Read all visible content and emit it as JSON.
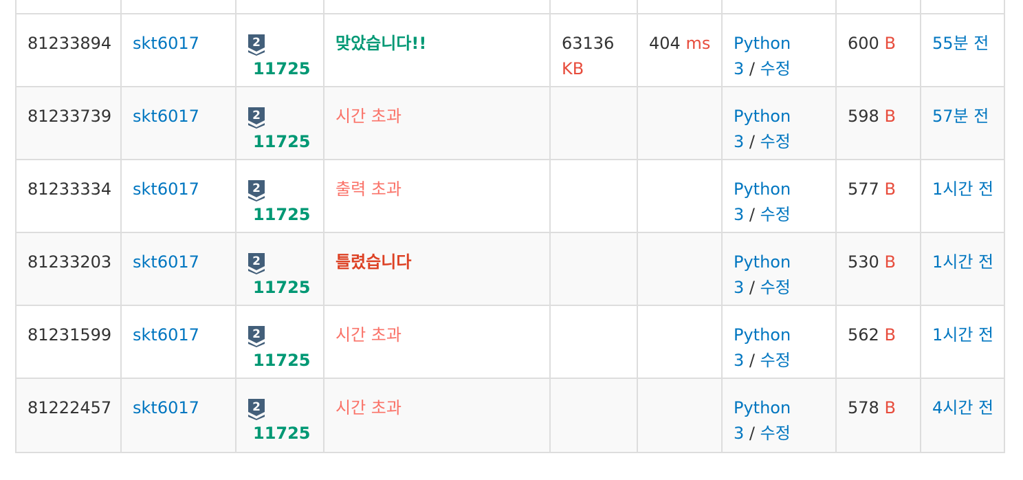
{
  "rows": [
    {
      "id": "81233894",
      "user": "skt6017",
      "problem": "11725",
      "result": "맞았습니다!!",
      "result_type": "ac",
      "memory": "63136",
      "memory_unit": "KB",
      "time": "404",
      "time_unit": "ms",
      "lang": "Python",
      "lang_ver": "3",
      "edit": "수정",
      "length": "600",
      "length_unit": "B",
      "submitted": "55분 전"
    },
    {
      "id": "81233739",
      "user": "skt6017",
      "problem": "11725",
      "result": "시간 초과",
      "result_type": "tle",
      "memory": "",
      "memory_unit": "",
      "time": "",
      "time_unit": "",
      "lang": "Python",
      "lang_ver": "3",
      "edit": "수정",
      "length": "598",
      "length_unit": "B",
      "submitted": "57분 전"
    },
    {
      "id": "81233334",
      "user": "skt6017",
      "problem": "11725",
      "result": "출력 초과",
      "result_type": "ole",
      "memory": "",
      "memory_unit": "",
      "time": "",
      "time_unit": "",
      "lang": "Python",
      "lang_ver": "3",
      "edit": "수정",
      "length": "577",
      "length_unit": "B",
      "submitted": "1시간 전"
    },
    {
      "id": "81233203",
      "user": "skt6017",
      "problem": "11725",
      "result": "틀렸습니다",
      "result_type": "wa",
      "memory": "",
      "memory_unit": "",
      "time": "",
      "time_unit": "",
      "lang": "Python",
      "lang_ver": "3",
      "edit": "수정",
      "length": "530",
      "length_unit": "B",
      "submitted": "1시간 전"
    },
    {
      "id": "81231599",
      "user": "skt6017",
      "problem": "11725",
      "result": "시간 초과",
      "result_type": "tle",
      "memory": "",
      "memory_unit": "",
      "time": "",
      "time_unit": "",
      "lang": "Python",
      "lang_ver": "3",
      "edit": "수정",
      "length": "562",
      "length_unit": "B",
      "submitted": "1시간 전"
    },
    {
      "id": "81222457",
      "user": "skt6017",
      "problem": "11725",
      "result": "시간 초과",
      "result_type": "tle",
      "memory": "",
      "memory_unit": "",
      "time": "",
      "time_unit": "",
      "lang": "Python",
      "lang_ver": "3",
      "edit": "수정",
      "length": "578",
      "length_unit": "B",
      "submitted": "4시간 전"
    }
  ],
  "tier_badge": {
    "icon": "silver-tier-icon",
    "number": "2",
    "color": "#435f7a"
  },
  "colors": {
    "link": "#0076c0",
    "accepted": "#009874",
    "time_limit": "#fa7268",
    "wrong": "#dd4124",
    "unit": "#e74c3c",
    "border": "#dddddd"
  }
}
